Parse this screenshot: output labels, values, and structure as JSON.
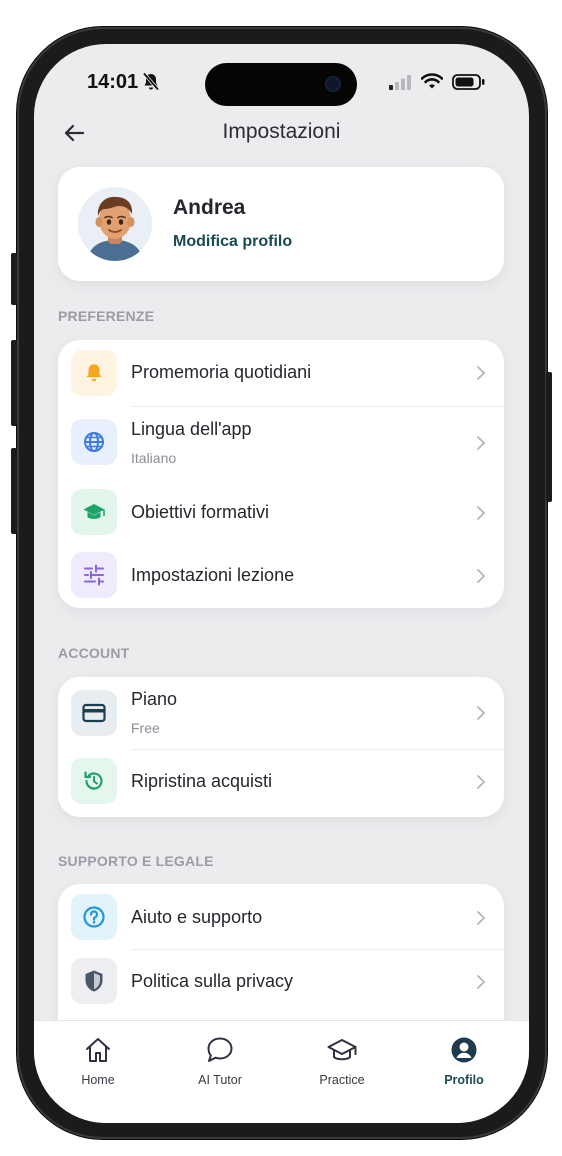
{
  "status_bar": {
    "time": "14:01"
  },
  "header": {
    "title": "Impostazioni"
  },
  "profile": {
    "name": "Andrea",
    "edit_label": "Modifica profilo"
  },
  "sections": {
    "preferences": {
      "title": "PREFERENZE",
      "items": [
        {
          "label": "Promemoria quotidiani",
          "icon": "bell-icon",
          "icon_color": "#f5a623",
          "icon_bg": "#fff3e2"
        },
        {
          "label": "Lingua dell'app",
          "sub": "Italiano",
          "icon": "globe-icon",
          "icon_color": "#3d7be0",
          "icon_bg": "#e8f0fd"
        },
        {
          "label": "Obiettivi formativi",
          "icon": "graduation-cap-icon",
          "icon_color": "#1fa36a",
          "icon_bg": "#e2f6ec"
        },
        {
          "label": "Impostazioni lezione",
          "icon": "sliders-icon",
          "icon_color": "#8a63e0",
          "icon_bg": "#f0ebfc"
        }
      ]
    },
    "account": {
      "title": "ACCOUNT",
      "items": [
        {
          "label": "Piano",
          "sub": "Free",
          "icon": "credit-card-icon",
          "icon_color": "#1c3f4f",
          "icon_bg": "#e7edf0"
        },
        {
          "label": "Ripristina acquisti",
          "icon": "restore-icon",
          "icon_color": "#1fa36a",
          "icon_bg": "#e5f6ec"
        }
      ]
    },
    "support": {
      "title": "SUPPORTO E LEGALE",
      "items": [
        {
          "label": "Aiuto e supporto",
          "icon": "help-circle-icon",
          "icon_color": "#1e98d6",
          "icon_bg": "#e3f3fb"
        },
        {
          "label": "Politica sulla privacy",
          "icon": "shield-icon",
          "icon_color": "#4a5568",
          "icon_bg": "#eceef2"
        }
      ]
    }
  },
  "tabbar": {
    "tabs": [
      {
        "label": "Home",
        "icon": "home-icon"
      },
      {
        "label": "AI Tutor",
        "icon": "chat-bubble-icon"
      },
      {
        "label": "Practice",
        "icon": "graduation-cap-icon"
      },
      {
        "label": "Profilo",
        "icon": "user-circle-icon",
        "active": true
      }
    ]
  },
  "colors": {
    "accent": "#1f4a58",
    "background": "#ececef"
  }
}
